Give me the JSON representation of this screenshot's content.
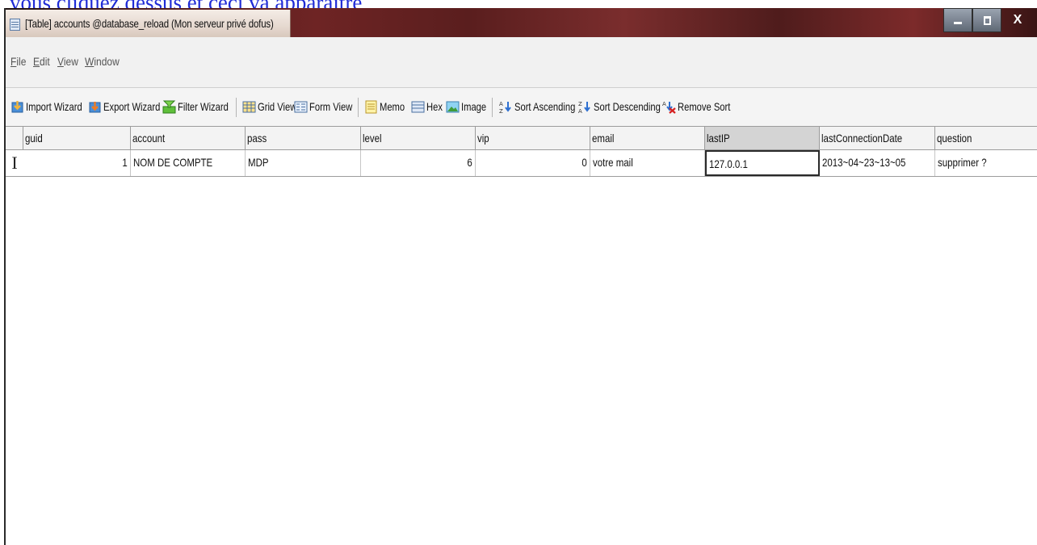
{
  "caption": "vous cliquez dessus et ceci va apparaitre",
  "window": {
    "title": "[Table] accounts @database_reload (Mon serveur privé dofus)",
    "controls": {
      "minimize_icon": "minimize-icon",
      "maximize_icon": "maximize-icon",
      "close_label": "X"
    }
  },
  "menu": [
    {
      "label": "File",
      "key": "F",
      "rest": "ile"
    },
    {
      "label": "Edit",
      "key": "E",
      "rest": "dit"
    },
    {
      "label": "View",
      "key": "V",
      "rest": "iew"
    },
    {
      "label": "Window",
      "key": "W",
      "rest": "indow"
    }
  ],
  "toolbar": {
    "import_wizard": "Import Wizard",
    "export_wizard": "Export Wizard",
    "filter_wizard": "Filter Wizard",
    "grid_view": "Grid View",
    "form_view": "Form View",
    "memo": "Memo",
    "hex": "Hex",
    "image": "Image",
    "sort_ascending": "Sort Ascending",
    "sort_descending": "Sort Descending",
    "remove_sort": "Remove Sort"
  },
  "table": {
    "columns": [
      "guid",
      "account",
      "pass",
      "level",
      "vip",
      "email",
      "lastIP",
      "lastConnectionDate",
      "question"
    ],
    "selected_column": "lastIP",
    "rows": [
      {
        "guid": "1",
        "account": "NOM DE COMPTE",
        "pass": "MDP",
        "level": "6",
        "vip": "0",
        "email": "votre mail",
        "lastIP": "127.0.0.1",
        "lastConnectionDate": "2013~04~23~13~05",
        "question": "supprimer ?"
      }
    ],
    "row_marker": "I"
  }
}
